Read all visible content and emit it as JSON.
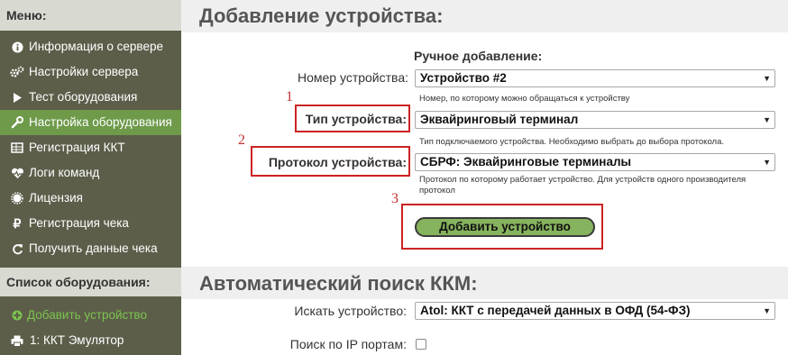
{
  "sidebar": {
    "menu_title": "Меню:",
    "items": [
      {
        "label": "Информация о сервере",
        "icon": "info-icon"
      },
      {
        "label": "Настройки сервера",
        "icon": "gears-icon"
      },
      {
        "label": "Тест оборудования",
        "icon": "play-icon"
      },
      {
        "label": "Настройка оборудования",
        "icon": "wrench-icon",
        "active": true
      },
      {
        "label": "Регистрация ККТ",
        "icon": "table-icon"
      },
      {
        "label": "Логи команд",
        "icon": "heartbeat-icon"
      },
      {
        "label": "Лицензия",
        "icon": "badge-icon"
      },
      {
        "label": "Регистрация чека",
        "icon": "ruble-icon"
      },
      {
        "label": "Получить данные чека",
        "icon": "refresh-icon"
      }
    ],
    "equipment_title": "Список оборудования:",
    "equipment": [
      {
        "label": "Добавить устройство",
        "icon": "plus-circle-icon"
      },
      {
        "label": "1: ККТ Эмулятор",
        "icon": "printer-icon"
      }
    ]
  },
  "main": {
    "add_title": "Добавление устройства:",
    "manual_heading": "Ручное добавление:",
    "device_number": {
      "label": "Номер устройства:",
      "value": "Устройство #2",
      "hint": "Номер, по которому можно обращаться к устройству"
    },
    "device_type": {
      "label": "Тип устройства:",
      "value": "Эквайринговый терминал",
      "hint": "Тип подключаемого устройства. Необходимо выбрать до выбора протокола."
    },
    "protocol": {
      "label": "Протокол устройства:",
      "value": "СБРФ: Эквайринговые терминалы",
      "hint_line1": "Протокол по которому работает устройство. Для устройств одного производителя",
      "hint_line2": "протокол"
    },
    "add_button": "Добавить устройство",
    "markers": [
      "1",
      "2",
      "3"
    ],
    "auto_title": "Автоматический поиск ККМ:",
    "search_device": {
      "label": "Искать устройство:",
      "value": "Atol: ККТ с передачей данных в ОФД (54-ФЗ)"
    },
    "ip_search": {
      "label": "Поиск по IP портам:",
      "checked": false
    }
  }
}
